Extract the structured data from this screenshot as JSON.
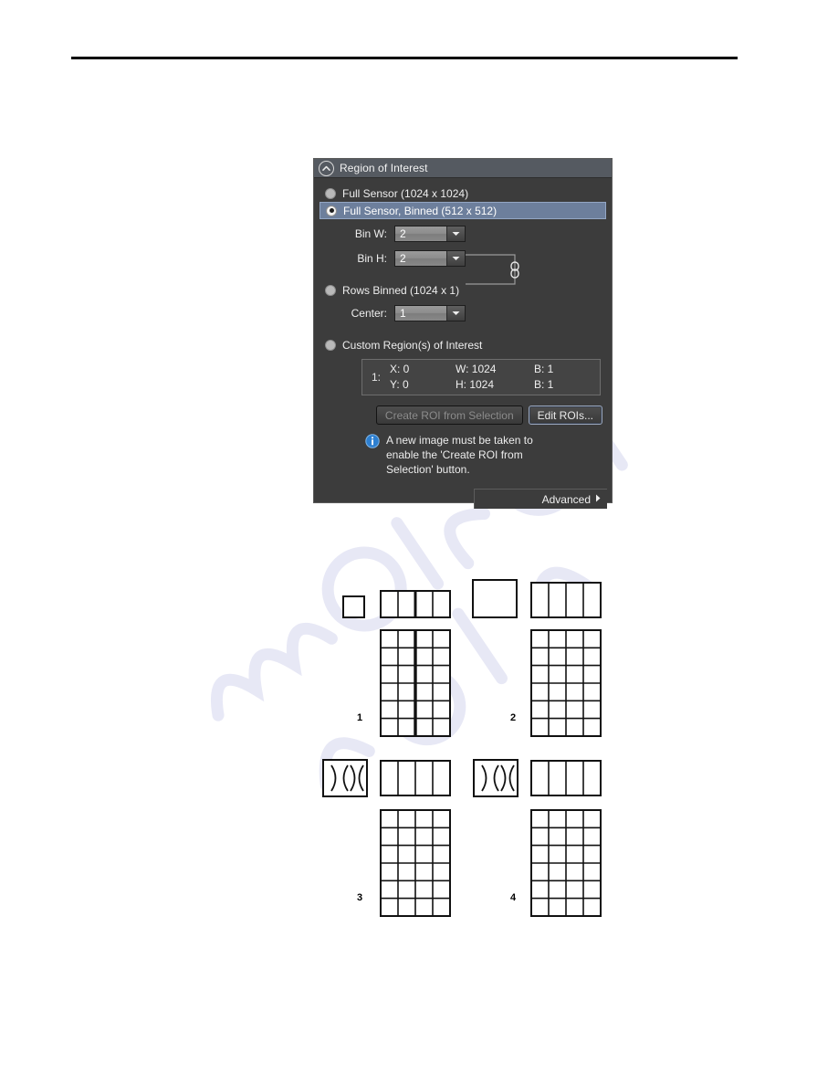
{
  "page": {
    "background_color": "#ffffff",
    "header_rule": true
  },
  "watermark": {
    "text": "manualshive.com"
  },
  "roi_panel": {
    "title": "Region of Interest",
    "collapse_icon": "chevron-up-icon",
    "panel_bg": "#3c3c3c",
    "titlebar_bg": "#555a61",
    "selection_color": "#6d7f9c",
    "options": [
      {
        "label": "Full Sensor (1024 x 1024)",
        "selected": false
      },
      {
        "label": "Full Sensor, Binned (512 x 512)",
        "selected": true
      },
      {
        "label": "Rows Binned (1024 x 1)",
        "selected": false
      },
      {
        "label": "Custom Region(s) of Interest",
        "selected": false
      }
    ],
    "fields": {
      "bin_w_label": "Bin W:",
      "bin_w_value": "2",
      "bin_h_label": "Bin H:",
      "bin_h_value": "2",
      "center_label": "Center:",
      "center_value": "1",
      "link_icon": "chain-link-icon"
    },
    "roi_list": {
      "index": "1:",
      "x_label": "X: 0",
      "y_label": "Y: 0",
      "w_label": "W: 1024",
      "h_label": "H: 1024",
      "b1_label": "B: 1",
      "b2_label": "B: 1"
    },
    "buttons": {
      "create_roi": "Create ROI from Selection",
      "create_roi_enabled": false,
      "edit_rois": "Edit ROIs...",
      "edit_rois_enabled": true,
      "advanced": "Advanced",
      "advanced_arrow": "chevron-right-icon"
    },
    "info": {
      "icon": "info-icon",
      "icon_color": "#2d7fd0",
      "line1": "A new image must be taken to",
      "line2": "enable the 'Create ROI from",
      "line3": "Selection' button."
    }
  },
  "binning_figure": {
    "caption_labels": [
      "1",
      "2",
      "3",
      "4"
    ],
    "panels": [
      {
        "number": "1",
        "pixel_icon": "single-small-square",
        "strip_cells": 4,
        "strip_divider_after": 2,
        "grid_cols": 4,
        "grid_rows": 6,
        "grid_divider_after_col": 2
      },
      {
        "number": "2",
        "pixel_icon": "single-large-square",
        "strip_cells": 4,
        "strip_divider_after": 0,
        "grid_cols": 4,
        "grid_rows": 6,
        "grid_divider_after_col": 0
      },
      {
        "number": "3",
        "pixel_icon": "lens-pair-square",
        "strip_cells": 4,
        "strip_divider_after": 0,
        "grid_cols": 4,
        "grid_rows": 6,
        "grid_divider_after_col": 0
      },
      {
        "number": "4",
        "pixel_icon": "lens-pair-square",
        "strip_cells": 4,
        "strip_divider_after": 0,
        "grid_cols": 4,
        "grid_rows": 6,
        "grid_divider_after_col": 0
      }
    ]
  }
}
